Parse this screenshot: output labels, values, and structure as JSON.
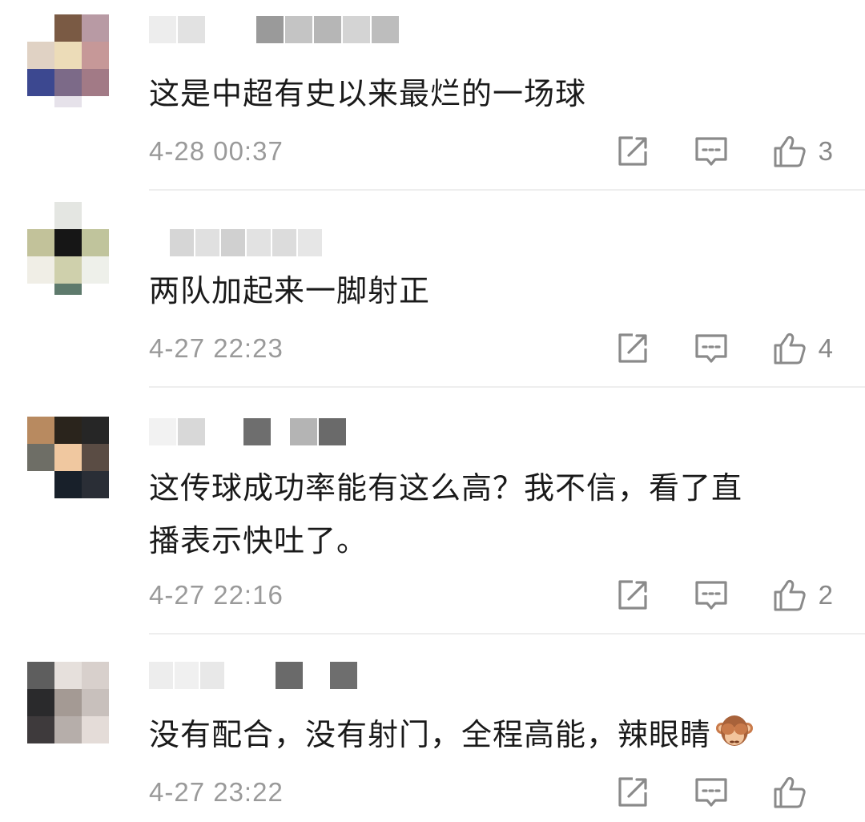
{
  "comments": [
    {
      "text": "这是中超有史以来最烂的一场球",
      "timestamp": "4-28 00:37",
      "likes": "3"
    },
    {
      "text": "两队加起来一脚射正",
      "timestamp": "4-27 22:23",
      "likes": "4"
    },
    {
      "text_line1": "这传球成功率能有这么高？我不信，看了直",
      "text_line2": "播表示快吐了。",
      "timestamp": "4-27 22:16",
      "likes": "2"
    },
    {
      "text": "没有配合，没有射门，全程高能，辣眼睛",
      "emoji": "see-no-evil-monkey",
      "timestamp": "4-27 23:22",
      "likes": ""
    }
  ],
  "icons": {
    "share": "share-icon",
    "reply": "reply-comment-icon",
    "like": "thumbs-up-icon"
  },
  "colors": {
    "timestamp": "#9a9a9a",
    "icon": "#8a8a8a",
    "divider": "#eeeeee"
  }
}
